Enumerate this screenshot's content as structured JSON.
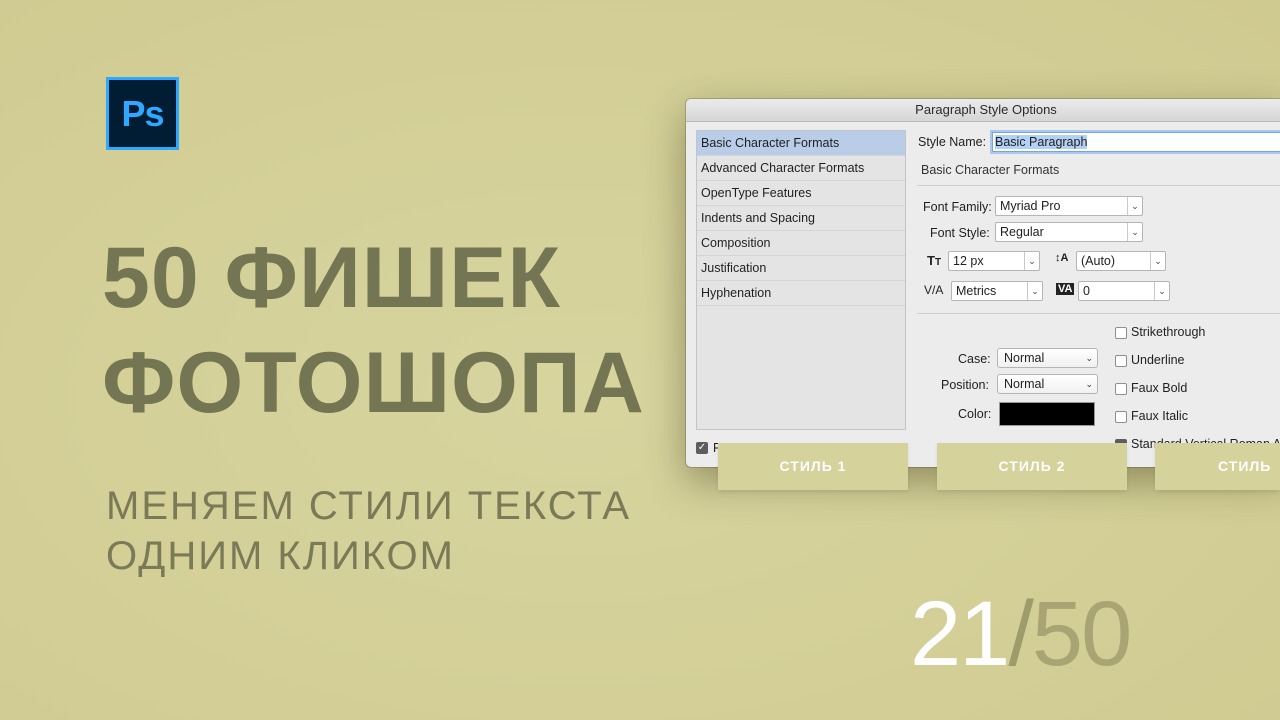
{
  "logo": {
    "text": "Ps",
    "border_color": "#31a8ff",
    "bg_color": "#001d34"
  },
  "headline": {
    "line1": "50 ФИШЕК",
    "line2": "ФОТОШОПА",
    "color": "#747552"
  },
  "subheadline": {
    "line1": "МЕНЯЕМ СТИЛИ ТЕКСТА",
    "line2": "ОДНИМ КЛИКОМ"
  },
  "counter": {
    "current": "21",
    "slash": "/",
    "total": "50"
  },
  "dialog": {
    "title": "Paragraph Style Options",
    "categories": [
      "Basic Character Formats",
      "Advanced Character Formats",
      "OpenType Features",
      "Indents and Spacing",
      "Composition",
      "Justification",
      "Hyphenation"
    ],
    "selected_category": "Basic Character Formats",
    "preview_label": "P",
    "style_name_label": "Style Name:",
    "style_name_value": "Basic Paragraph",
    "section_title": "Basic Character Formats",
    "font_family_label": "Font Family:",
    "font_family_value": "Myriad Pro",
    "font_style_label": "Font Style:",
    "font_style_value": "Regular",
    "font_size_value": "12 px",
    "leading_value": "(Auto)",
    "kerning_value": "Metrics",
    "tracking_value": "0",
    "case_label": "Case:",
    "case_value": "Normal",
    "position_label": "Position:",
    "position_value": "Normal",
    "color_label": "Color:",
    "color_value": "#000000",
    "checkboxes": [
      {
        "label": "Strikethrough",
        "checked": false
      },
      {
        "label": "Underline",
        "checked": false
      },
      {
        "label": "Faux Bold",
        "checked": false
      },
      {
        "label": "Faux Italic",
        "checked": false
      },
      {
        "label": "Standard Vertical Roman A",
        "checked": true
      }
    ]
  },
  "style_buttons": [
    "СТИЛЬ 1",
    "СТИЛЬ 2",
    "СТИЛЬ"
  ]
}
